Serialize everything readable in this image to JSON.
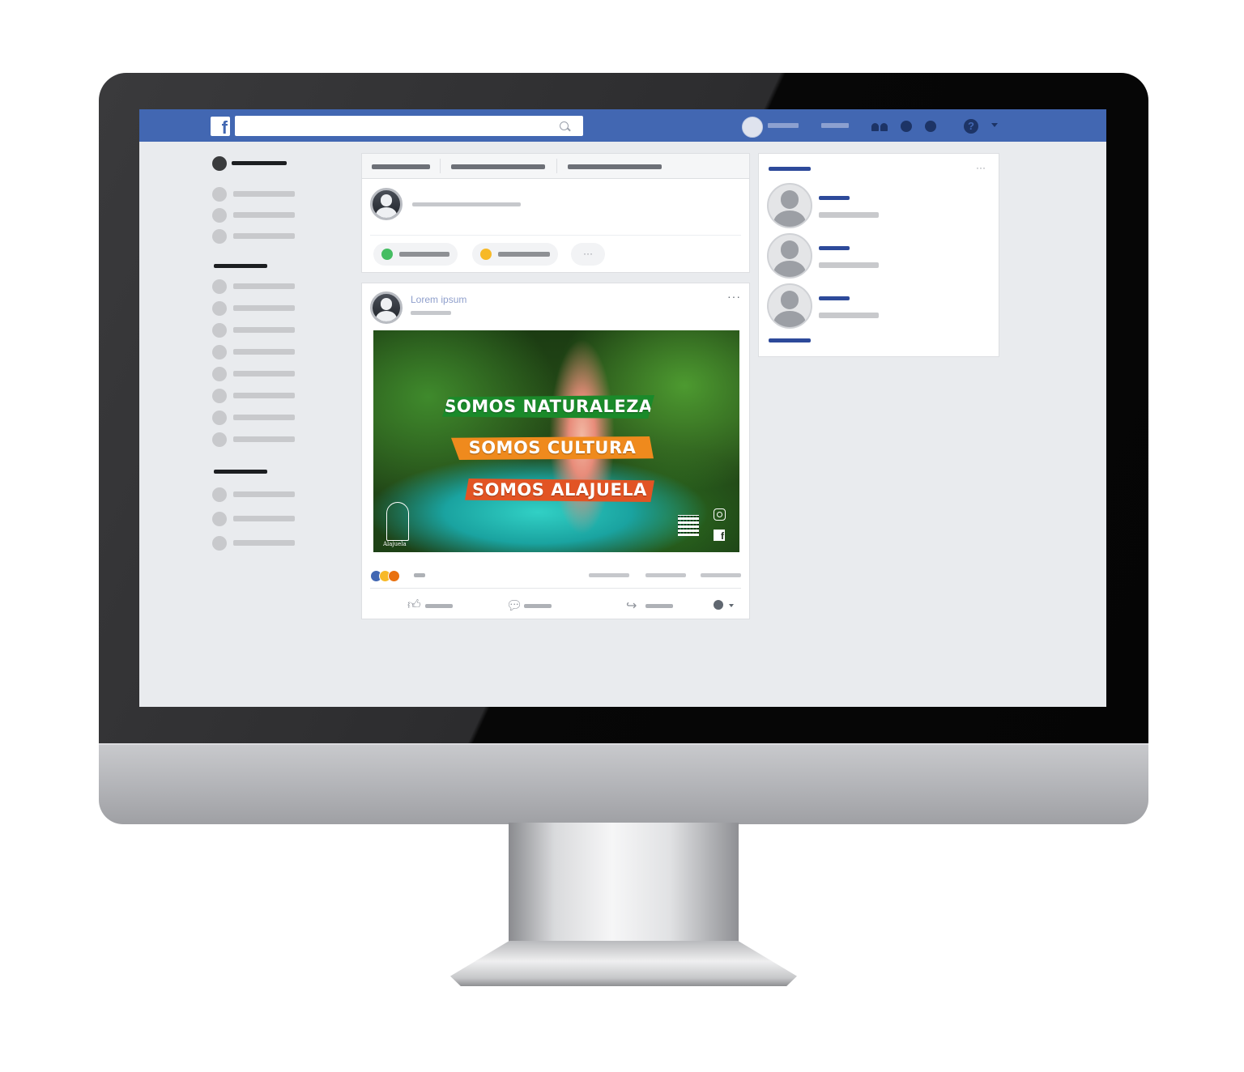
{
  "browser": {
    "logo_letter": "f",
    "help_glyph": "?"
  },
  "post": {
    "author": "Lorem ipsum",
    "menu": "···",
    "image": {
      "line1": "SOMOS NATURALEZA",
      "line2": "SOMOS CULTURA",
      "line3": "SOMOS ALAJUELA",
      "brand": "Alajuela",
      "fb_letter": "f"
    },
    "reaction_colors": [
      "#4267b2",
      "#f7b928",
      "#e9710f"
    ]
  },
  "composer": {
    "more": "···"
  },
  "sidebar_right": {
    "menu": "···"
  },
  "colors": {
    "facebook_blue": "#4267b2",
    "green_ribbon": "#1a8a2a",
    "orange_ribbon": "#ef8a1d",
    "red_ribbon": "#e25424"
  },
  "icons": [
    "search-icon",
    "friends-icon",
    "messages-icon",
    "globe-icon",
    "help-icon",
    "like-icon",
    "comment-icon",
    "share-icon",
    "instagram-icon",
    "qr-code-icon"
  ]
}
